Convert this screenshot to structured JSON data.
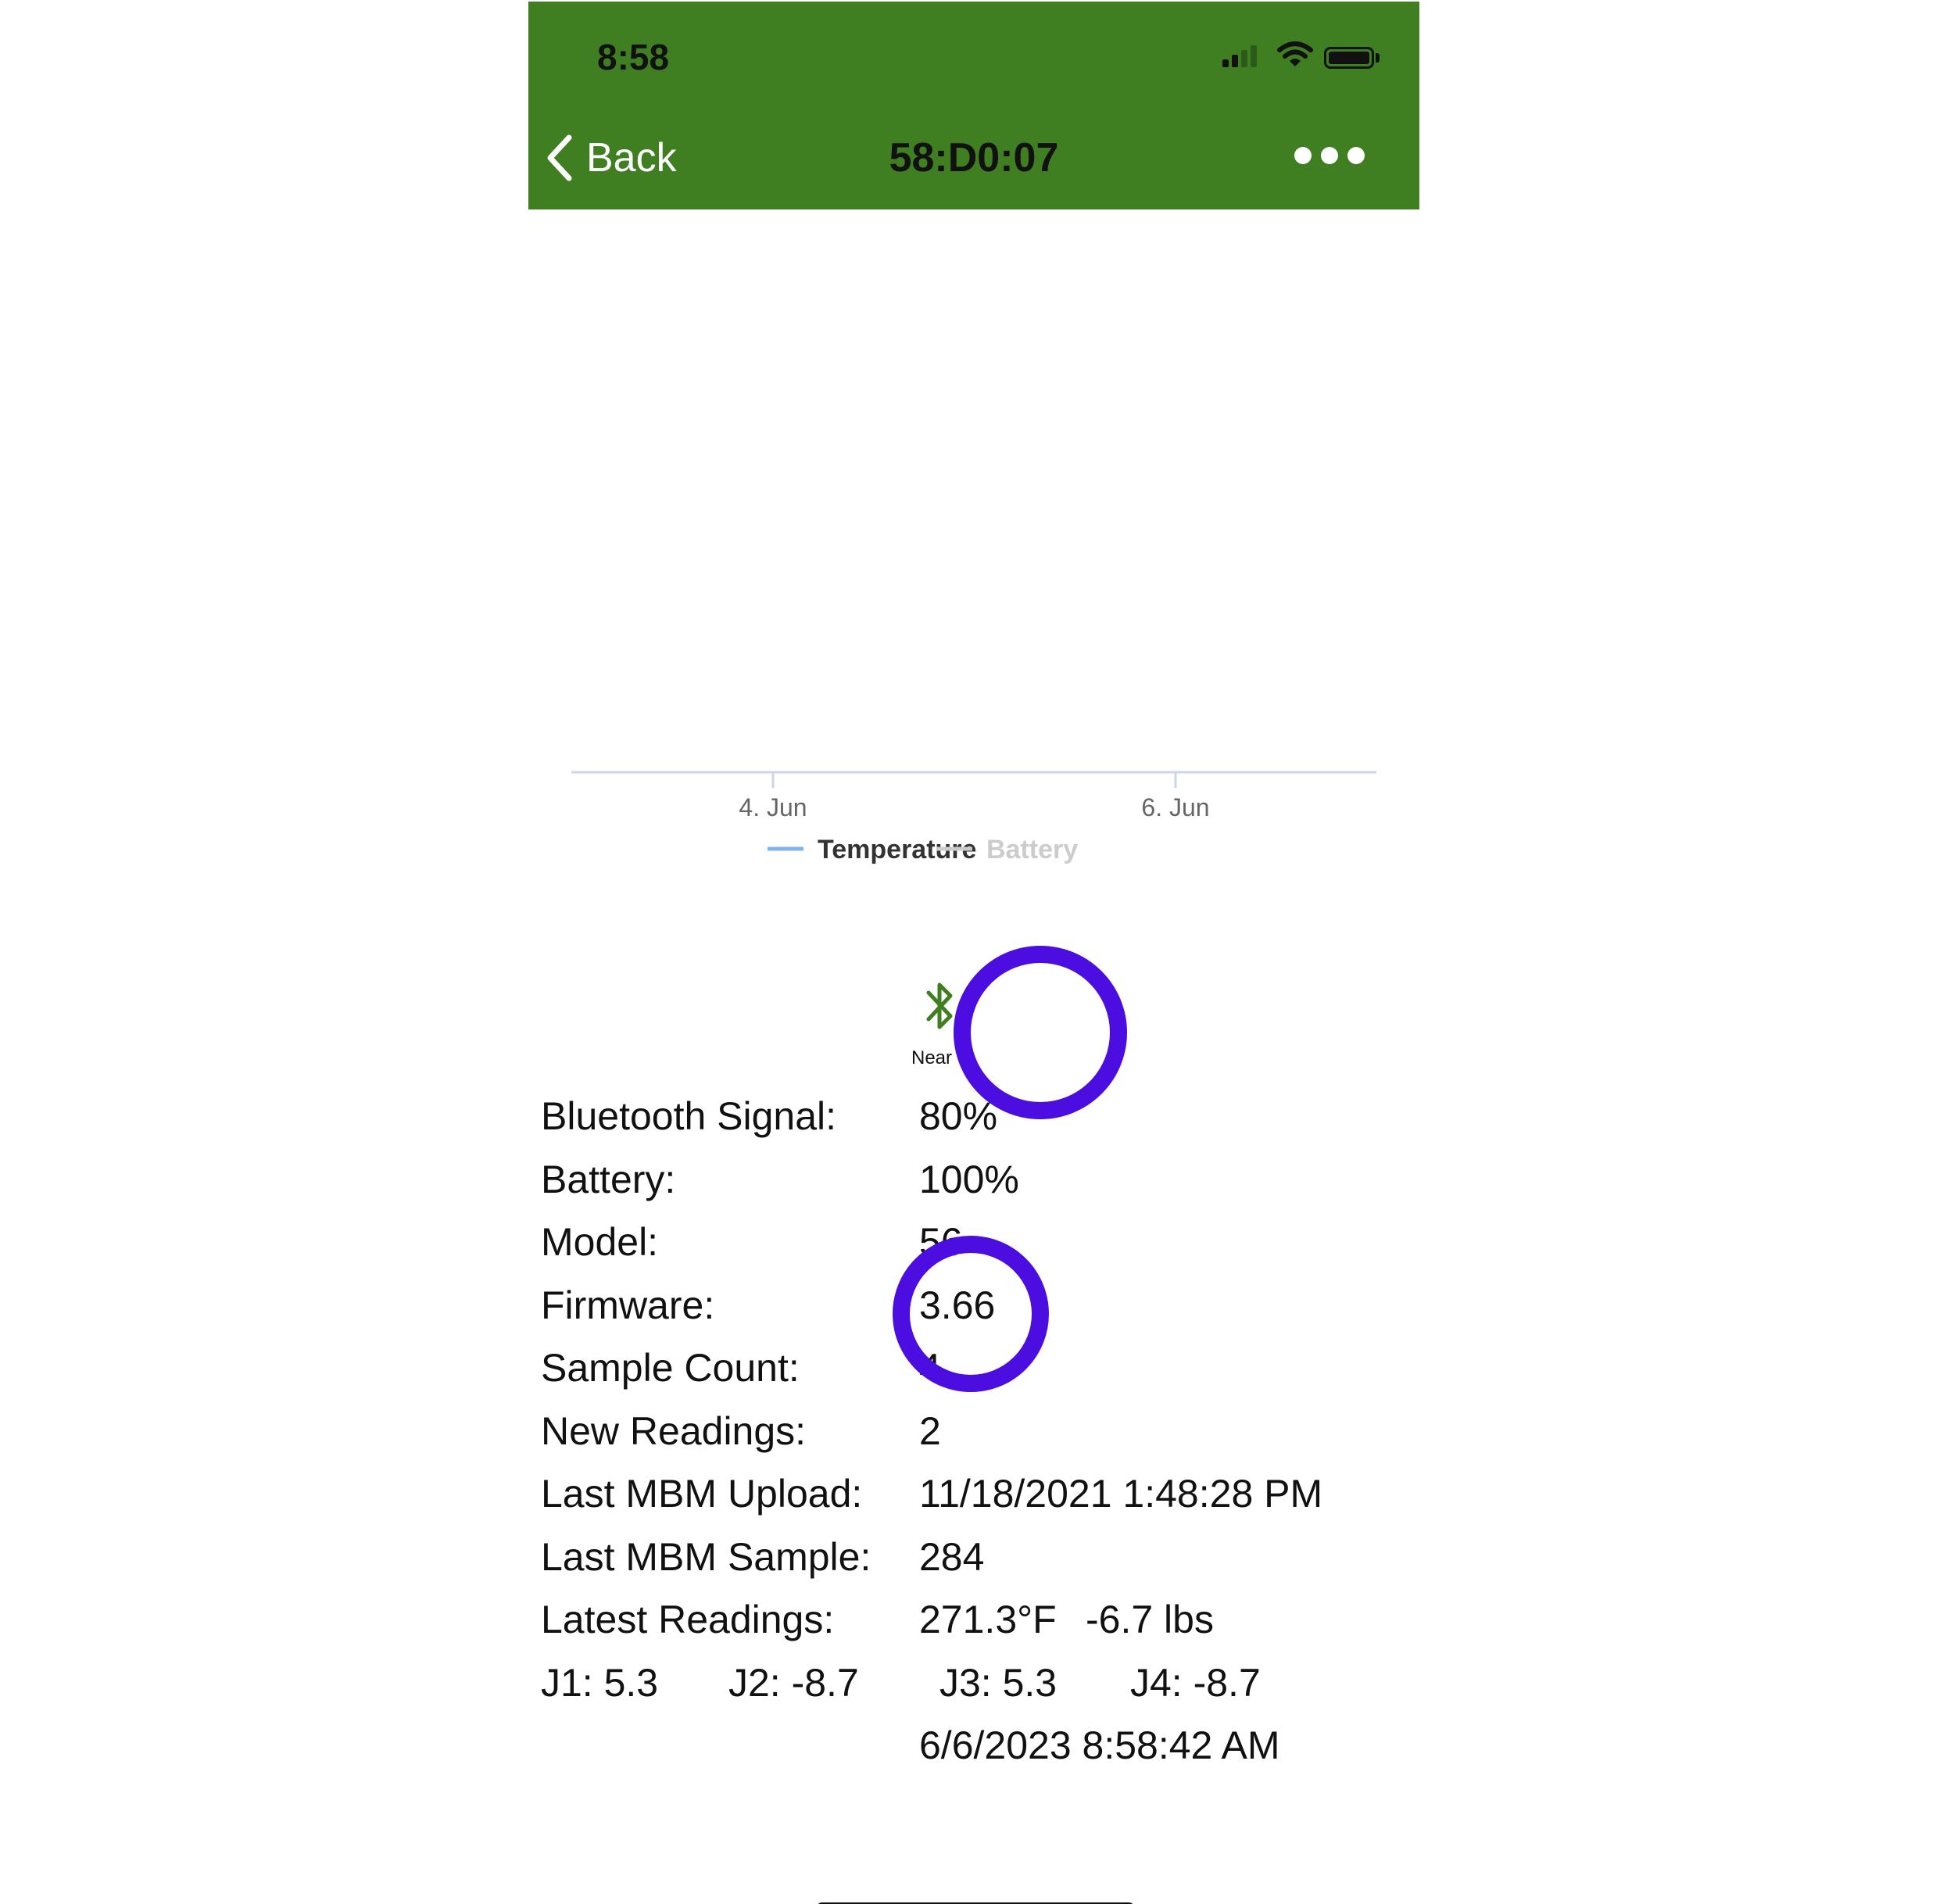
{
  "colors": {
    "header_bg": "#3f7f22",
    "temperature_series": "#7cb5ec",
    "battery_series": "#cccccc",
    "bluetooth_icon": "#3f7f22",
    "highlight": "#4b0de0"
  },
  "status_bar": {
    "time": "8:58",
    "icons": [
      "signal-icon",
      "wifi-icon",
      "battery-icon"
    ]
  },
  "nav": {
    "back_label": "Back",
    "title": "58:D0:07",
    "more_icon": "ellipsis-icon"
  },
  "chart_data": {
    "type": "line",
    "x_ticks": [
      "4. Jun",
      "6. Jun"
    ],
    "series": [
      {
        "name": "Temperature",
        "values": [],
        "active": true
      },
      {
        "name": "Battery",
        "values": [],
        "active": false
      }
    ],
    "legend_position": "bottom",
    "grid": false
  },
  "device_status": {
    "icon": "bluetooth-icon",
    "label": "Near"
  },
  "details": {
    "bluetooth_signal": {
      "label": "Bluetooth Signal:",
      "value": "80%"
    },
    "battery": {
      "label": "Battery:",
      "value": "100%"
    },
    "model": {
      "label": "Model:",
      "value": "56"
    },
    "firmware": {
      "label": "Firmware:",
      "value": "3.66"
    },
    "sample_count": {
      "label": "Sample Count:",
      "value": "4"
    },
    "new_readings": {
      "label": "New Readings:",
      "value": "2"
    },
    "last_mbm_upload": {
      "label": "Last MBM Upload:",
      "value": "11/18/2021 1:48:28 PM"
    },
    "last_mbm_sample": {
      "label": "Last MBM Sample:",
      "value": "284"
    },
    "latest_readings": {
      "label": "Latest Readings:",
      "temperature": "271.3°F",
      "weight": "-6.7 lbs"
    },
    "junctions": [
      "J1: 5.3",
      "J2: -8.7",
      "J3: 5.3",
      "J4: -8.7"
    ],
    "reading_timestamp": "6/6/2023 8:58:42 AM"
  }
}
